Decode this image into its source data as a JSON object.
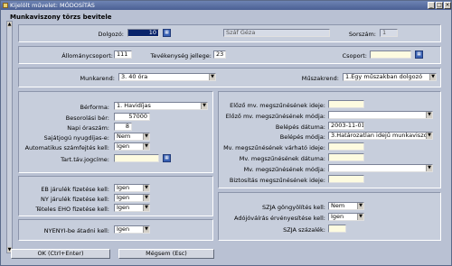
{
  "window": {
    "title": "Kijelölt művelet: MÓDOSÍTÁS",
    "min": "_",
    "max": "□",
    "close": "×"
  },
  "heading": "Munkaviszony törzs bevitele",
  "top": {
    "dolgozo_label": "Dolgozó:",
    "dolgozo_value": "10",
    "dolgozo_name": "Száf Géza",
    "sorszam_label": "Sorszám:",
    "sorszam_value": "1"
  },
  "row2": {
    "allomany_label": "Állománycsoport:",
    "allomany_value": "111",
    "tev_label": "Tevékenység jellege:",
    "tev_value": "23",
    "csoport_label": "Csoport:",
    "csoport_value": ""
  },
  "row3": {
    "munkarend_label": "Munkarend:",
    "munkarend_value": "3. 40 óra",
    "muszakrend_label": "Műszakrend:",
    "muszakrend_value": "1.Egy műszakban dolgozó"
  },
  "left": {
    "berforma_label": "Bérforma:",
    "berforma_value": "1. Havidíjas",
    "besorolasi_label": "Besorolási bér:",
    "besorolasi_value": "57000",
    "napi_label": "Napi óraszám:",
    "napi_value": "8",
    "sajatjogu_label": "Sajátjogú nyugdíjas-e:",
    "sajatjogu_value": "Nem",
    "auto_label": "Automatikus számfejtés kell:",
    "auto_value": "Igen",
    "tartav_label": "Tart.táv.jogcíme:",
    "tartav_value": ""
  },
  "left2": {
    "eb_label": "EB járulék fizetése kell:",
    "eb_value": "Igen",
    "ny_label": "NY járulék fizetése kell:",
    "ny_value": "Igen",
    "eho_label": "Tételes EHO fizetése kell:",
    "eho_value": "Igen"
  },
  "left3": {
    "nyenyi_label": "NYENYI-be átadni kell:",
    "nyenyi_value": "Igen"
  },
  "right": {
    "elozo_label": "Előző mv. megszűnésének ideje:",
    "elozo_value": "",
    "elozo_mod_label": "Előző mv. megszűnésének módja:",
    "elozo_mod_value": "",
    "belepes_label": "Belépés dátuma:",
    "belepes_value": "2003-11-01",
    "belepes_mod_label": "Belépés módja:",
    "belepes_mod_value": "3.Határozatlan idejű munkaviszony",
    "mv_varhato_label": "Mv. megszűnésének várható ideje:",
    "mv_varhato_value": "",
    "mv_datum_label": "Mv. megszűnésének dátuma:",
    "mv_datum_value": "",
    "mv_mod_label": "Mv. megszűnésének módja:",
    "mv_mod_value": "",
    "bizt_label": "Biztosítás megszűnésének ideje:",
    "bizt_value": ""
  },
  "right2": {
    "szja_gong_label": "SZJA göngyölítés kell:",
    "szja_gong_value": "Nem",
    "adojovairas_label": "Adójóváírás érvényesítése kell:",
    "adojovairas_value": "Igen",
    "szja_szaz_label": "SZJA százalék:",
    "szja_szaz_value": ""
  },
  "buttons": {
    "ok": "OK (Ctrl+Enter)",
    "cancel": "Mégsem (Esc)"
  },
  "icons": {
    "dropdown": "▼",
    "picker": "▦",
    "scroll_up": "▲",
    "scroll_down": "▼"
  }
}
